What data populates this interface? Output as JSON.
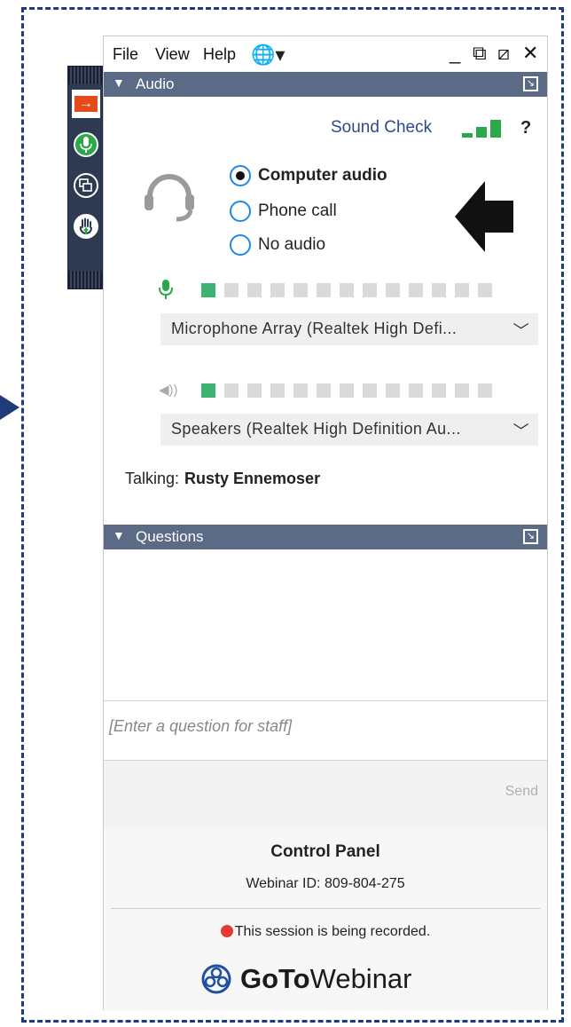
{
  "menu": {
    "file": "File",
    "view": "View",
    "help": "Help",
    "globe_icon": "globe-icon"
  },
  "window_controls": {
    "minimize": "_",
    "restore": "⧉",
    "popout": "⧄",
    "close": "✕"
  },
  "audio_section": {
    "title": "Audio",
    "sound_check": "Sound Check",
    "help": "?",
    "options": [
      {
        "label": "Computer audio",
        "selected": true
      },
      {
        "label": "Phone call",
        "selected": false
      },
      {
        "label": "No audio",
        "selected": false
      }
    ],
    "mic_device": "Microphone Array (Realtek High Defi...",
    "speaker_device": "Speakers (Realtek High Definition Au...",
    "mic_level_segments_on": 1,
    "speaker_level_segments_on": 1,
    "level_segments_total": 13,
    "talking_label": "Talking:",
    "talking_name": "Rusty Ennemoser"
  },
  "questions_section": {
    "title": "Questions",
    "placeholder": "[Enter a question for staff]",
    "send_label": "Send"
  },
  "footer": {
    "title": "Control Panel",
    "webinar_id": "Webinar ID: 809-804-275",
    "recording_notice": "This session is being recorded.",
    "logo_goto": "GoTo",
    "logo_webinar": "Webinar"
  },
  "colors": {
    "header_bg": "#5b6a85",
    "toolbar_bg": "#2e3a52",
    "accent_green": "#2aa84a",
    "accent_blue": "#2f4a8a",
    "frame_blue": "#1f3b7a",
    "record_red": "#e53935"
  }
}
